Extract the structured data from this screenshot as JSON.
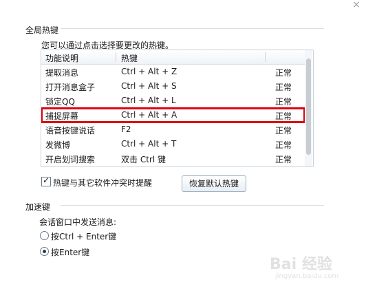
{
  "window": {
    "close_glyph": "×"
  },
  "global_hotkeys": {
    "title": "全局热键",
    "hint": "您可以通过点击选择要更改的热键。",
    "columns": [
      "功能说明",
      "热键",
      ""
    ],
    "rows": [
      {
        "function": "提取消息",
        "hotkey": "Ctrl + Alt + Z",
        "status": "正常"
      },
      {
        "function": "打开消息盒子",
        "hotkey": "Ctrl + Alt + S",
        "status": "正常"
      },
      {
        "function": "锁定QQ",
        "hotkey": "Ctrl + Alt + L",
        "status": "正常"
      },
      {
        "function": "捕捉屏幕",
        "hotkey": "Ctrl + Alt + A",
        "status": "正常"
      },
      {
        "function": "语音按键说话",
        "hotkey": "F2",
        "status": "正常"
      },
      {
        "function": "发微博",
        "hotkey": "Ctrl + Alt + T",
        "status": "正常"
      },
      {
        "function": "开启划词搜索",
        "hotkey": "双击 Ctrl 键",
        "status": "正常"
      }
    ],
    "highlight_color": "#e0000f",
    "conflict_checkbox": {
      "label": "热键与其它软件冲突时提醒",
      "checked": true
    },
    "restore_button": "恢复默认热键"
  },
  "accelerator": {
    "title": "加速键",
    "send_label": "会话窗口中发送消息:",
    "options": [
      {
        "label": "按Ctrl + Enter键",
        "selected": false
      },
      {
        "label": "按Enter键",
        "selected": true
      }
    ]
  },
  "watermark": {
    "logo": "Bai 经验",
    "url": "jingyan.baidu.com"
  }
}
